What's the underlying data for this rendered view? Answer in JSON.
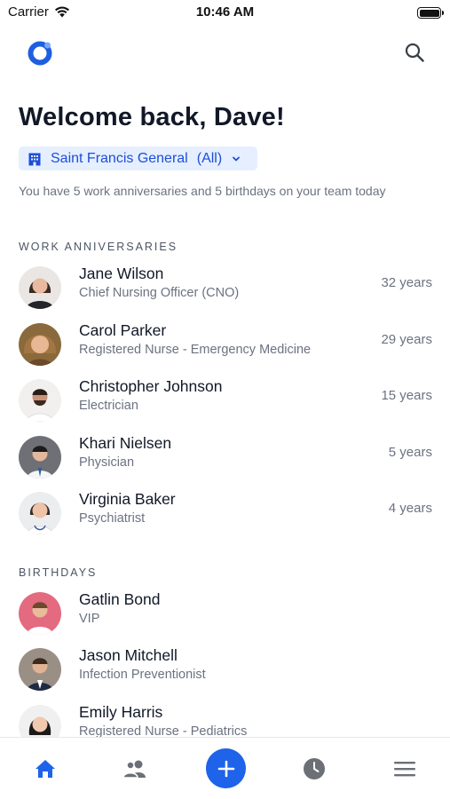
{
  "status_bar": {
    "carrier": "Carrier",
    "time": "10:46 AM"
  },
  "header": {
    "welcome": "Welcome back, Dave!"
  },
  "facility": {
    "label": "Saint Francis General",
    "scope": "(All)"
  },
  "summary": "You have 5 work anniversaries and 5 birthdays on your team today",
  "anniversaries": {
    "title": "WORK ANNIVERSARIES",
    "people": [
      {
        "name": "Jane Wilson",
        "role": "Chief Nursing Officer (CNO)",
        "years": "32 years"
      },
      {
        "name": "Carol Parker",
        "role": "Registered Nurse - Emergency Medicine",
        "years": "29 years"
      },
      {
        "name": "Christopher Johnson",
        "role": "Electrician",
        "years": "15 years"
      },
      {
        "name": "Khari Nielsen",
        "role": "Physician",
        "years": "5 years"
      },
      {
        "name": "Virginia Baker",
        "role": "Psychiatrist",
        "years": "4 years"
      }
    ]
  },
  "birthdays": {
    "title": "BIRTHDAYS",
    "people": [
      {
        "name": "Gatlin Bond",
        "role": "VIP"
      },
      {
        "name": "Jason Mitchell",
        "role": "Infection Preventionist"
      },
      {
        "name": "Emily Harris",
        "role": "Registered Nurse - Pediatrics"
      }
    ]
  },
  "tabs": [
    "home-icon",
    "team-icon",
    "add-icon",
    "clock-icon",
    "menu-icon"
  ],
  "colors": {
    "accent": "#1e63e9",
    "pill_bg": "#e6efff",
    "active_tab": "#1e63e9",
    "inactive_tab": "#6b6f76"
  }
}
